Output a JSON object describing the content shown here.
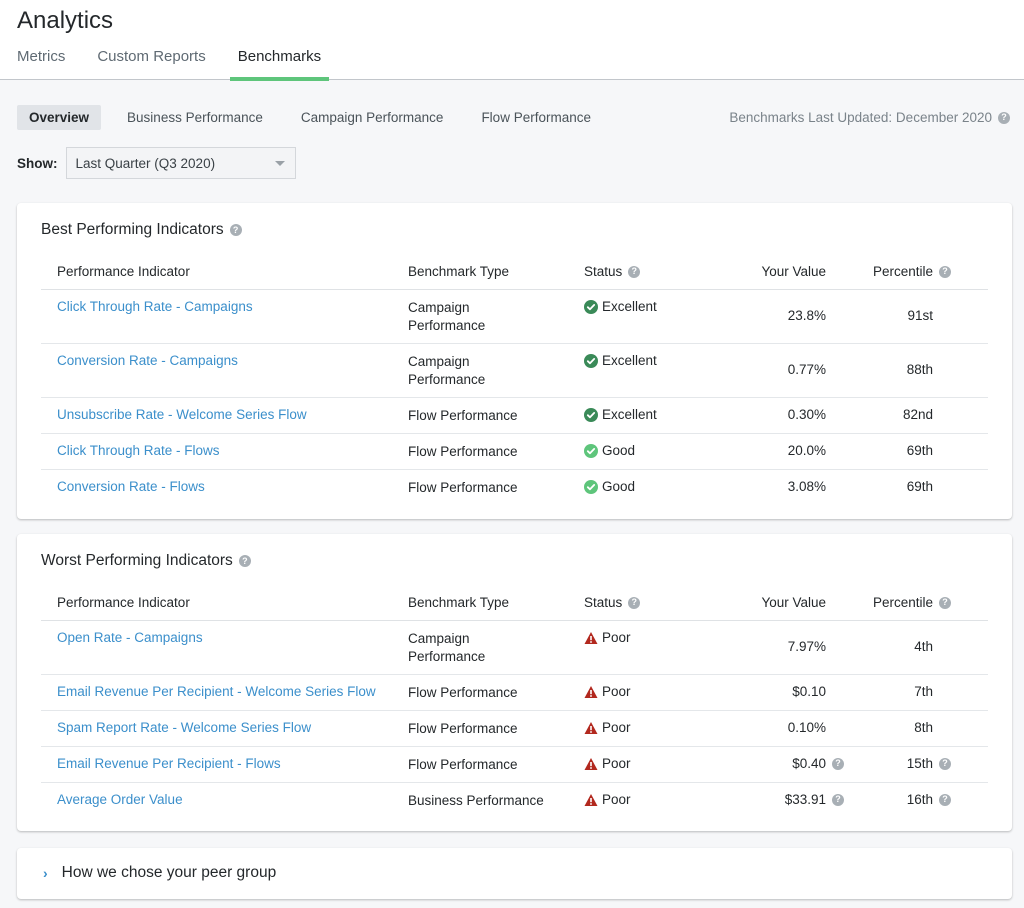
{
  "header": {
    "title": "Analytics",
    "tabs": [
      {
        "label": "Metrics",
        "active": false
      },
      {
        "label": "Custom Reports",
        "active": false
      },
      {
        "label": "Benchmarks",
        "active": true
      }
    ]
  },
  "subnav": {
    "tabs": [
      {
        "label": "Overview",
        "active": true
      },
      {
        "label": "Business Performance",
        "active": false
      },
      {
        "label": "Campaign Performance",
        "active": false
      },
      {
        "label": "Flow Performance",
        "active": false
      }
    ],
    "last_updated": "Benchmarks Last Updated: December 2020"
  },
  "filter": {
    "label": "Show:",
    "selected": "Last Quarter (Q3 2020)"
  },
  "columns": {
    "indicator": "Performance Indicator",
    "type": "Benchmark Type",
    "status": "Status",
    "value": "Your Value",
    "percentile": "Percentile"
  },
  "colors": {
    "link": "#3b8fcb",
    "excellent": "#3a8a58",
    "good": "#5ec57b",
    "poor": "#b2281e",
    "tab_underline": "#5ec57b"
  },
  "best": {
    "title": "Best Performing Indicators",
    "rows": [
      {
        "indicator": "Click Through Rate - Campaigns",
        "type": "Campaign Performance",
        "type_lines": [
          "Campaign",
          "Performance"
        ],
        "status": "Excellent",
        "value": "23.8%",
        "percentile": "91st"
      },
      {
        "indicator": "Conversion Rate - Campaigns",
        "type": "Campaign Performance",
        "type_lines": [
          "Campaign",
          "Performance"
        ],
        "status": "Excellent",
        "value": "0.77%",
        "percentile": "88th"
      },
      {
        "indicator": "Unsubscribe Rate - Welcome Series Flow",
        "type": "Flow Performance",
        "status": "Excellent",
        "value": "0.30%",
        "percentile": "82nd"
      },
      {
        "indicator": "Click Through Rate - Flows",
        "type": "Flow Performance",
        "status": "Good",
        "value": "20.0%",
        "percentile": "69th"
      },
      {
        "indicator": "Conversion Rate - Flows",
        "type": "Flow Performance",
        "status": "Good",
        "value": "3.08%",
        "percentile": "69th"
      }
    ]
  },
  "worst": {
    "title": "Worst Performing Indicators",
    "rows": [
      {
        "indicator": "Open Rate - Campaigns",
        "type": "Campaign Performance",
        "type_lines": [
          "Campaign",
          "Performance"
        ],
        "status": "Poor",
        "value": "7.97%",
        "percentile": "4th"
      },
      {
        "indicator": "Email Revenue Per Recipient - Welcome Series Flow",
        "type": "Flow Performance",
        "status": "Poor",
        "value": "$0.10",
        "percentile": "7th"
      },
      {
        "indicator": "Spam Report Rate - Welcome Series Flow",
        "type": "Flow Performance",
        "status": "Poor",
        "value": "0.10%",
        "percentile": "8th"
      },
      {
        "indicator": "Email Revenue Per Recipient - Flows",
        "type": "Flow Performance",
        "status": "Poor",
        "value": "$0.40",
        "percentile": "15th",
        "value_help": true,
        "percentile_help": true
      },
      {
        "indicator": "Average Order Value",
        "type": "Business Performance",
        "status": "Poor",
        "value": "$33.91",
        "percentile": "16th",
        "value_help": true,
        "percentile_help": true
      }
    ]
  },
  "peer_group": {
    "label": "How we chose your peer group",
    "icon": "chevron-right-icon"
  }
}
